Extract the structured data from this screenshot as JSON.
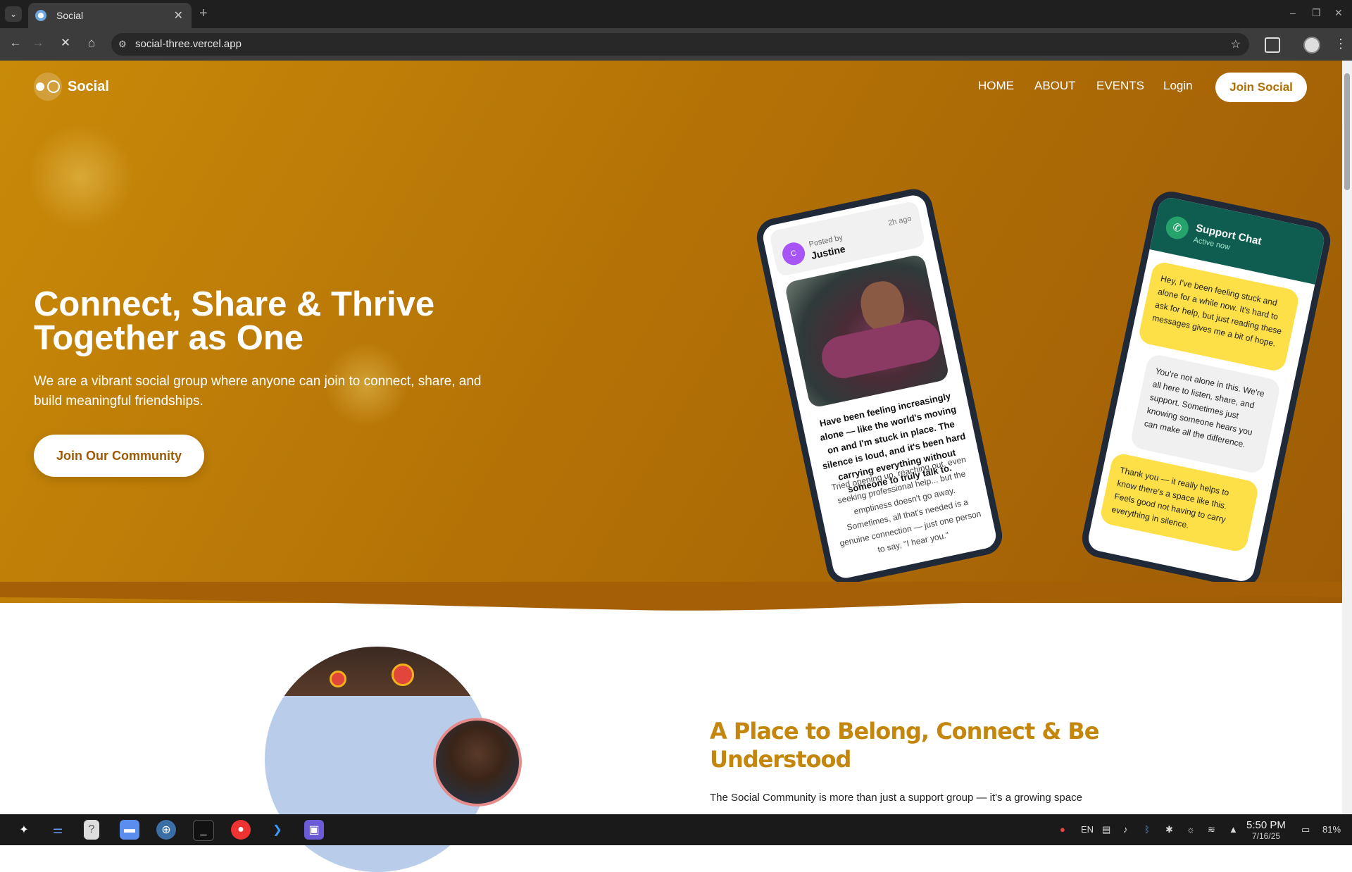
{
  "browser": {
    "tab_title": "Social",
    "url": "social-three.vercel.app"
  },
  "nav": {
    "logo": "Social",
    "links": [
      "HOME",
      "ABOUT",
      "EVENTS",
      "Login"
    ],
    "join_label": "Join Social"
  },
  "hero": {
    "title": "Connect, Share & Thrive Together as One",
    "subtitle": "We are a vibrant social group where anyone can join to connect, share, and build meaningful friendships.",
    "cta_label": "Join Our Community"
  },
  "post_card": {
    "avatar_letter": "C",
    "posted_by_label": "Posted by",
    "author": "Justine",
    "time_ago": "2h ago",
    "bold_text": "Have been feeling increasingly alone — like the world's moving on and I'm stuck in place. The silence is loud, and it's been hard carrying everything without someone to truly talk to.",
    "body_text": "Tried opening up, reaching out, even seeking professional help... but the emptiness doesn't go away. Sometimes, all that's needed is a genuine connection — just one person to say, \"I hear you.\""
  },
  "chat_card": {
    "title": "Support Chat",
    "status": "Active now",
    "messages": [
      "Hey, I've been feeling stuck and alone for a while now. It's hard to ask for help, but just reading these messages gives me a bit of hope.",
      "You're not alone in this. We're all here to listen, share, and support. Sometimes just knowing someone hears you can make all the difference.",
      "Thank you — it really helps to know there's a space like this. Feels good not having to carry everything in silence."
    ]
  },
  "belong": {
    "heading": "A Place to Belong, Connect & Be Understood",
    "paragraph": "The Social Community is more than just a support group — it's a growing space"
  },
  "taskbar": {
    "lang": "EN",
    "time": "5:50 PM",
    "date": "7/16/25",
    "battery": "81%"
  },
  "colors": {
    "hero_start": "#c98a09",
    "hero_end": "#9e5c06",
    "accent_heading": "#c4860d",
    "chat_header": "#0f5c50",
    "bubble_yellow": "#fde047"
  }
}
